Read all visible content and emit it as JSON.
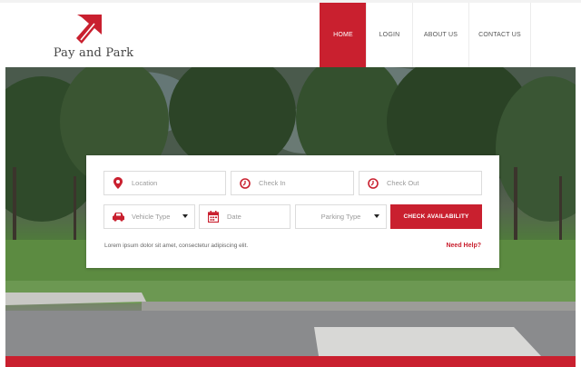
{
  "brand": {
    "name": "Pay and Park",
    "logo_icon": "diagonal-arrow-logo",
    "accent_color": "#c9202f"
  },
  "nav": {
    "items": [
      {
        "label": "HOME",
        "active": true
      },
      {
        "label": "LOGIN",
        "active": false
      },
      {
        "label": "ABOUT US",
        "active": false
      },
      {
        "label": "CONTACT US",
        "active": false
      }
    ]
  },
  "search": {
    "location": {
      "placeholder": "Location",
      "icon": "map-pin-icon"
    },
    "check_in": {
      "placeholder": "Check In",
      "icon": "clock-icon"
    },
    "check_out": {
      "placeholder": "Check Out",
      "icon": "clock-icon"
    },
    "vehicle_type": {
      "value": "Vehicle Type",
      "icon": "car-icon"
    },
    "date": {
      "placeholder": "Date",
      "icon": "calendar-icon"
    },
    "parking_type": {
      "value": "Parking Type"
    },
    "submit_label": "CHECK AVAILABILITY",
    "note": "Lorem ipsum dolor sit amet, consectetur adipiscing elit.",
    "help_link": "Need Help?"
  }
}
